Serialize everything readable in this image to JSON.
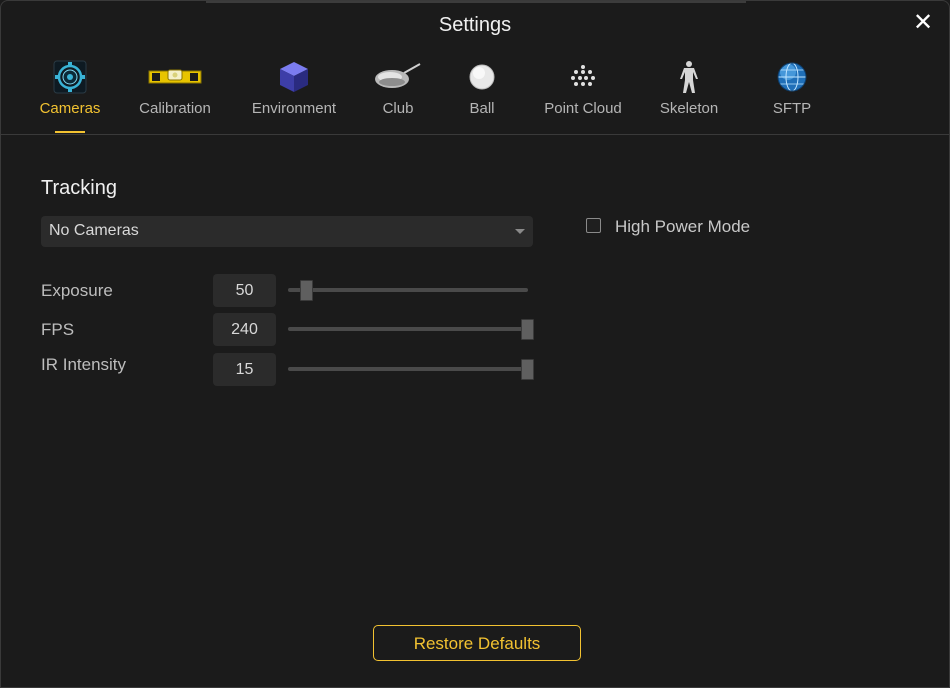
{
  "window": {
    "title": "Settings",
    "close_icon": "close-icon"
  },
  "tabs": [
    {
      "label": "Cameras",
      "icon": "camera-icon",
      "active": true
    },
    {
      "label": "Calibration",
      "icon": "level-icon",
      "active": false
    },
    {
      "label": "Environment",
      "icon": "cube-icon",
      "active": false
    },
    {
      "label": "Club",
      "icon": "golf-club-icon",
      "active": false
    },
    {
      "label": "Ball",
      "icon": "ball-icon",
      "active": false
    },
    {
      "label": "Point Cloud",
      "icon": "point-cloud-icon",
      "active": false
    },
    {
      "label": "Skeleton",
      "icon": "skeleton-icon",
      "active": false
    },
    {
      "label": "SFTP",
      "icon": "globe-icon",
      "active": false
    }
  ],
  "tracking": {
    "title": "Tracking",
    "camera_select": {
      "value": "No Cameras"
    },
    "high_power_mode": {
      "label": "High Power Mode",
      "checked": false
    },
    "params": [
      {
        "label": "Exposure",
        "value": "50",
        "slider_fraction": 0.05
      },
      {
        "label": "FPS",
        "value": "240",
        "slider_fraction": 1.0
      },
      {
        "label": "IR Intensity",
        "value": "15",
        "slider_fraction": 1.0
      }
    ]
  },
  "footer": {
    "restore_label": "Restore Defaults"
  },
  "colors": {
    "accent": "#f2c231",
    "background": "#1b1b1b",
    "field": "#2b2b2b"
  }
}
